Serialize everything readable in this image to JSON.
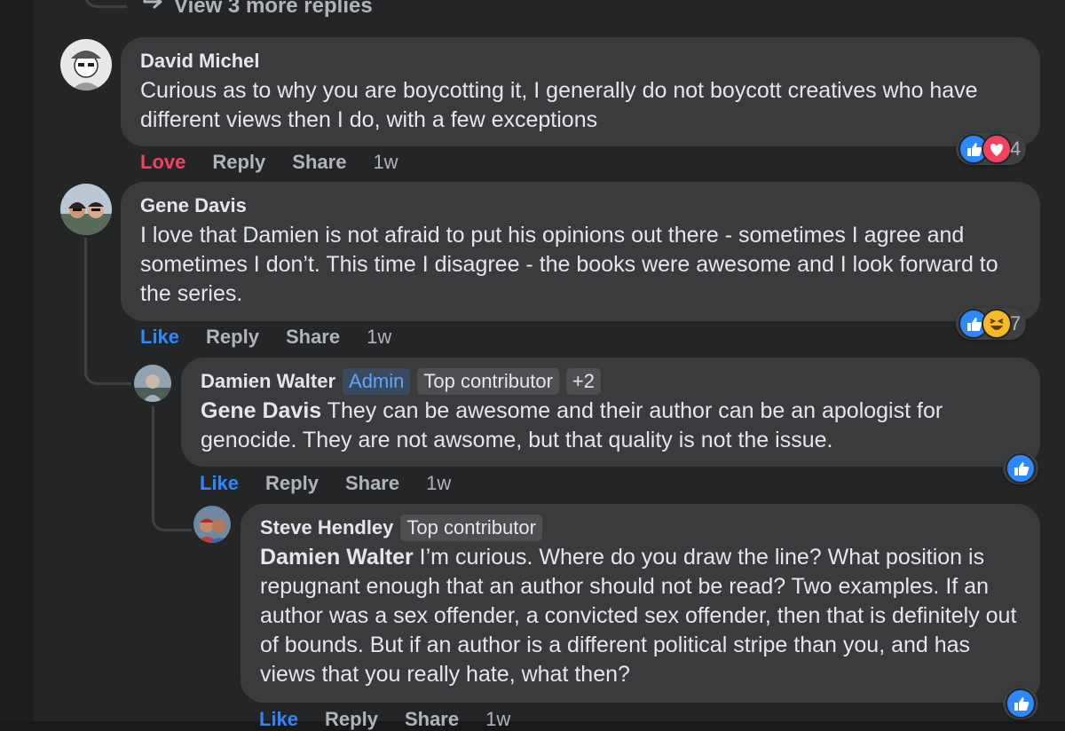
{
  "thread": {
    "more_replies_label": "View 3 more replies"
  },
  "comments": [
    {
      "author": "David Michel",
      "text": "Curious as to why you are boycotting it, I generally do not boycott creatives who have different views then I do, with a few exceptions",
      "actions": {
        "react": "Love",
        "reply": "Reply",
        "share": "Share",
        "time": "1w"
      },
      "reactions": {
        "icons": [
          "like-icon",
          "love-icon"
        ],
        "count": "4"
      }
    },
    {
      "author": "Gene Davis",
      "text": "I love that Damien is not afraid to put his opinions out there - sometimes I agree and sometimes I don’t. This time I disagree - the books were awesome and I look forward to the series.",
      "actions": {
        "react": "Like",
        "reply": "Reply",
        "share": "Share",
        "time": "1w"
      },
      "reactions": {
        "icons": [
          "like-icon",
          "haha-icon"
        ],
        "count": "7"
      }
    },
    {
      "author": "Damien Walter",
      "badges": [
        "Admin",
        "Top contributor",
        "+2"
      ],
      "mention": "Gene Davis",
      "text": " They can be awesome and their author can be an apologist for genocide. They are not awsome, but that quality is not the issue.",
      "actions": {
        "react": "Like",
        "reply": "Reply",
        "share": "Share",
        "time": "1w"
      },
      "reactions": {
        "icons": [
          "like-icon"
        ]
      }
    },
    {
      "author": "Steve Hendley",
      "badges": [
        "Top contributor"
      ],
      "mention": "Damien Walter",
      "text": " I’m curious. Where do you draw the line? What position is repugnant enough that an author should not be read? Two examples. If an author was a sex offender, a convicted sex offender, then that is definitely out of bounds. But if an author is a different political stripe than you, and has views that you really hate, what then?",
      "actions": {
        "react": "Like",
        "reply": "Reply",
        "share": "Share",
        "time": "1w"
      },
      "reactions": {
        "icons": [
          "like-icon"
        ]
      }
    }
  ],
  "colors": {
    "like": "#2d88ff",
    "love": "#f3425f",
    "haha": "#f7b928",
    "bubble": "#3a3b3c",
    "panel": "#242526"
  }
}
